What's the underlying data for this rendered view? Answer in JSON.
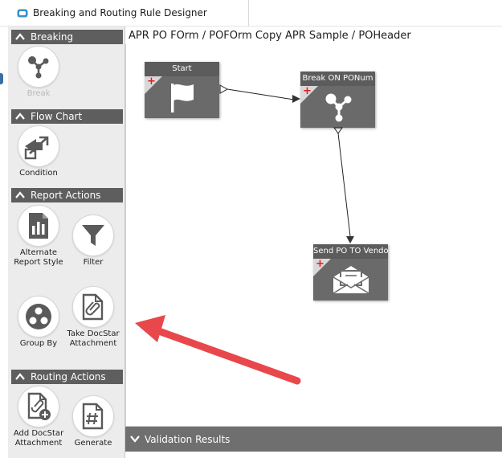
{
  "window": {
    "title": "Breaking and Routing Rule Designer"
  },
  "palette": {
    "sections": {
      "breaking": {
        "header": "Breaking",
        "tools": {
          "break": "Break"
        }
      },
      "flow_chart": {
        "header": "Flow Chart",
        "tools": {
          "condition": "Condition"
        }
      },
      "report_actions": {
        "header": "Report Actions",
        "tools": {
          "alternate_report_style": "Alternate Report Style",
          "filter": "Filter",
          "group_by": "Group By",
          "take_docstar_attachment": "Take DocStar Attachment"
        }
      },
      "routing_actions": {
        "header": "Routing Actions",
        "tools": {
          "add_docstar_attachment": "Add DocStar Attachment",
          "generate": "Generate"
        }
      }
    }
  },
  "canvas": {
    "breadcrumb": "APR PO FOrm / POFOrm Copy APR Sample / POHeader",
    "nodes": {
      "start": {
        "title": "Start",
        "icon": "flag-icon"
      },
      "break": {
        "title": "Break ON PONum",
        "icon": "break-icon"
      },
      "send": {
        "title": "Send PO TO Vendo",
        "icon": "envelope-icon"
      }
    }
  },
  "validation": {
    "label": "Validation Results"
  },
  "annotation": {
    "arrow_color": "#e8474c"
  },
  "colors": {
    "accent": "#3a8fc8",
    "node_bg": "#6a6a6a",
    "header_bg": "#5e5e5e",
    "plus_red": "#e01b1b"
  }
}
